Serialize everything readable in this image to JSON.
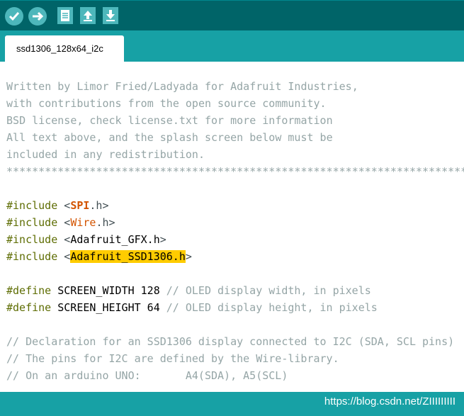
{
  "toolbar": {
    "buttons": [
      {
        "name": "verify-button",
        "icon": "check-icon"
      },
      {
        "name": "upload-button",
        "icon": "arrow-right-icon"
      },
      {
        "name": "new-button",
        "icon": "new-file-icon"
      },
      {
        "name": "open-button",
        "icon": "arrow-up-icon"
      },
      {
        "name": "save-button",
        "icon": "arrow-down-icon"
      }
    ]
  },
  "tab": {
    "label": "ssd1306_128x64_i2c"
  },
  "comment": {
    "l1": " Written by Limor Fried/Ladyada for Adafruit Industries,",
    "l2": " with contributions from the open source community.",
    "l3": " BSD license, check license.txt for more information",
    "l4": " All text above, and the splash screen below must be",
    "l5": " included in any redistribution.",
    "l6": " **************************************************************************"
  },
  "includes": [
    {
      "kw": "#include",
      "lt": " <",
      "lib": "SPI",
      "ext": ".h>"
    },
    {
      "kw": "#include",
      "lt": " <",
      "lib": "Wire",
      "ext": ".h>"
    },
    {
      "kw": "#include",
      "lt": " <",
      "lib": "Adafruit_GFX.h",
      "ext": ">"
    },
    {
      "kw": "#include",
      "lt": " <",
      "lib": "Adafruit_SSD1306.h",
      "ext": ">"
    }
  ],
  "defines": [
    {
      "kw": "#define",
      "rest": " SCREEN_WIDTH 128 ",
      "comment": "// OLED display width, in pixels"
    },
    {
      "kw": "#define",
      "rest": " SCREEN_HEIGHT 64 ",
      "comment": "// OLED display height, in pixels"
    }
  ],
  "comments2": {
    "l1": "// Declaration for an SSD1306 display connected to I2C (SDA, SCL pins)",
    "l2": "// The pins for I2C are defined by the Wire-library.",
    "l3": "// On an arduino UNO:       A4(SDA), A5(SCL)"
  },
  "watermark": "https://blog.csdn.net/ZIIIIIIIII",
  "colors": {
    "toolbar": "#006468",
    "tabbar": "#17a1a5",
    "button": "#4db7bb",
    "highlight": "#ffcc00"
  }
}
